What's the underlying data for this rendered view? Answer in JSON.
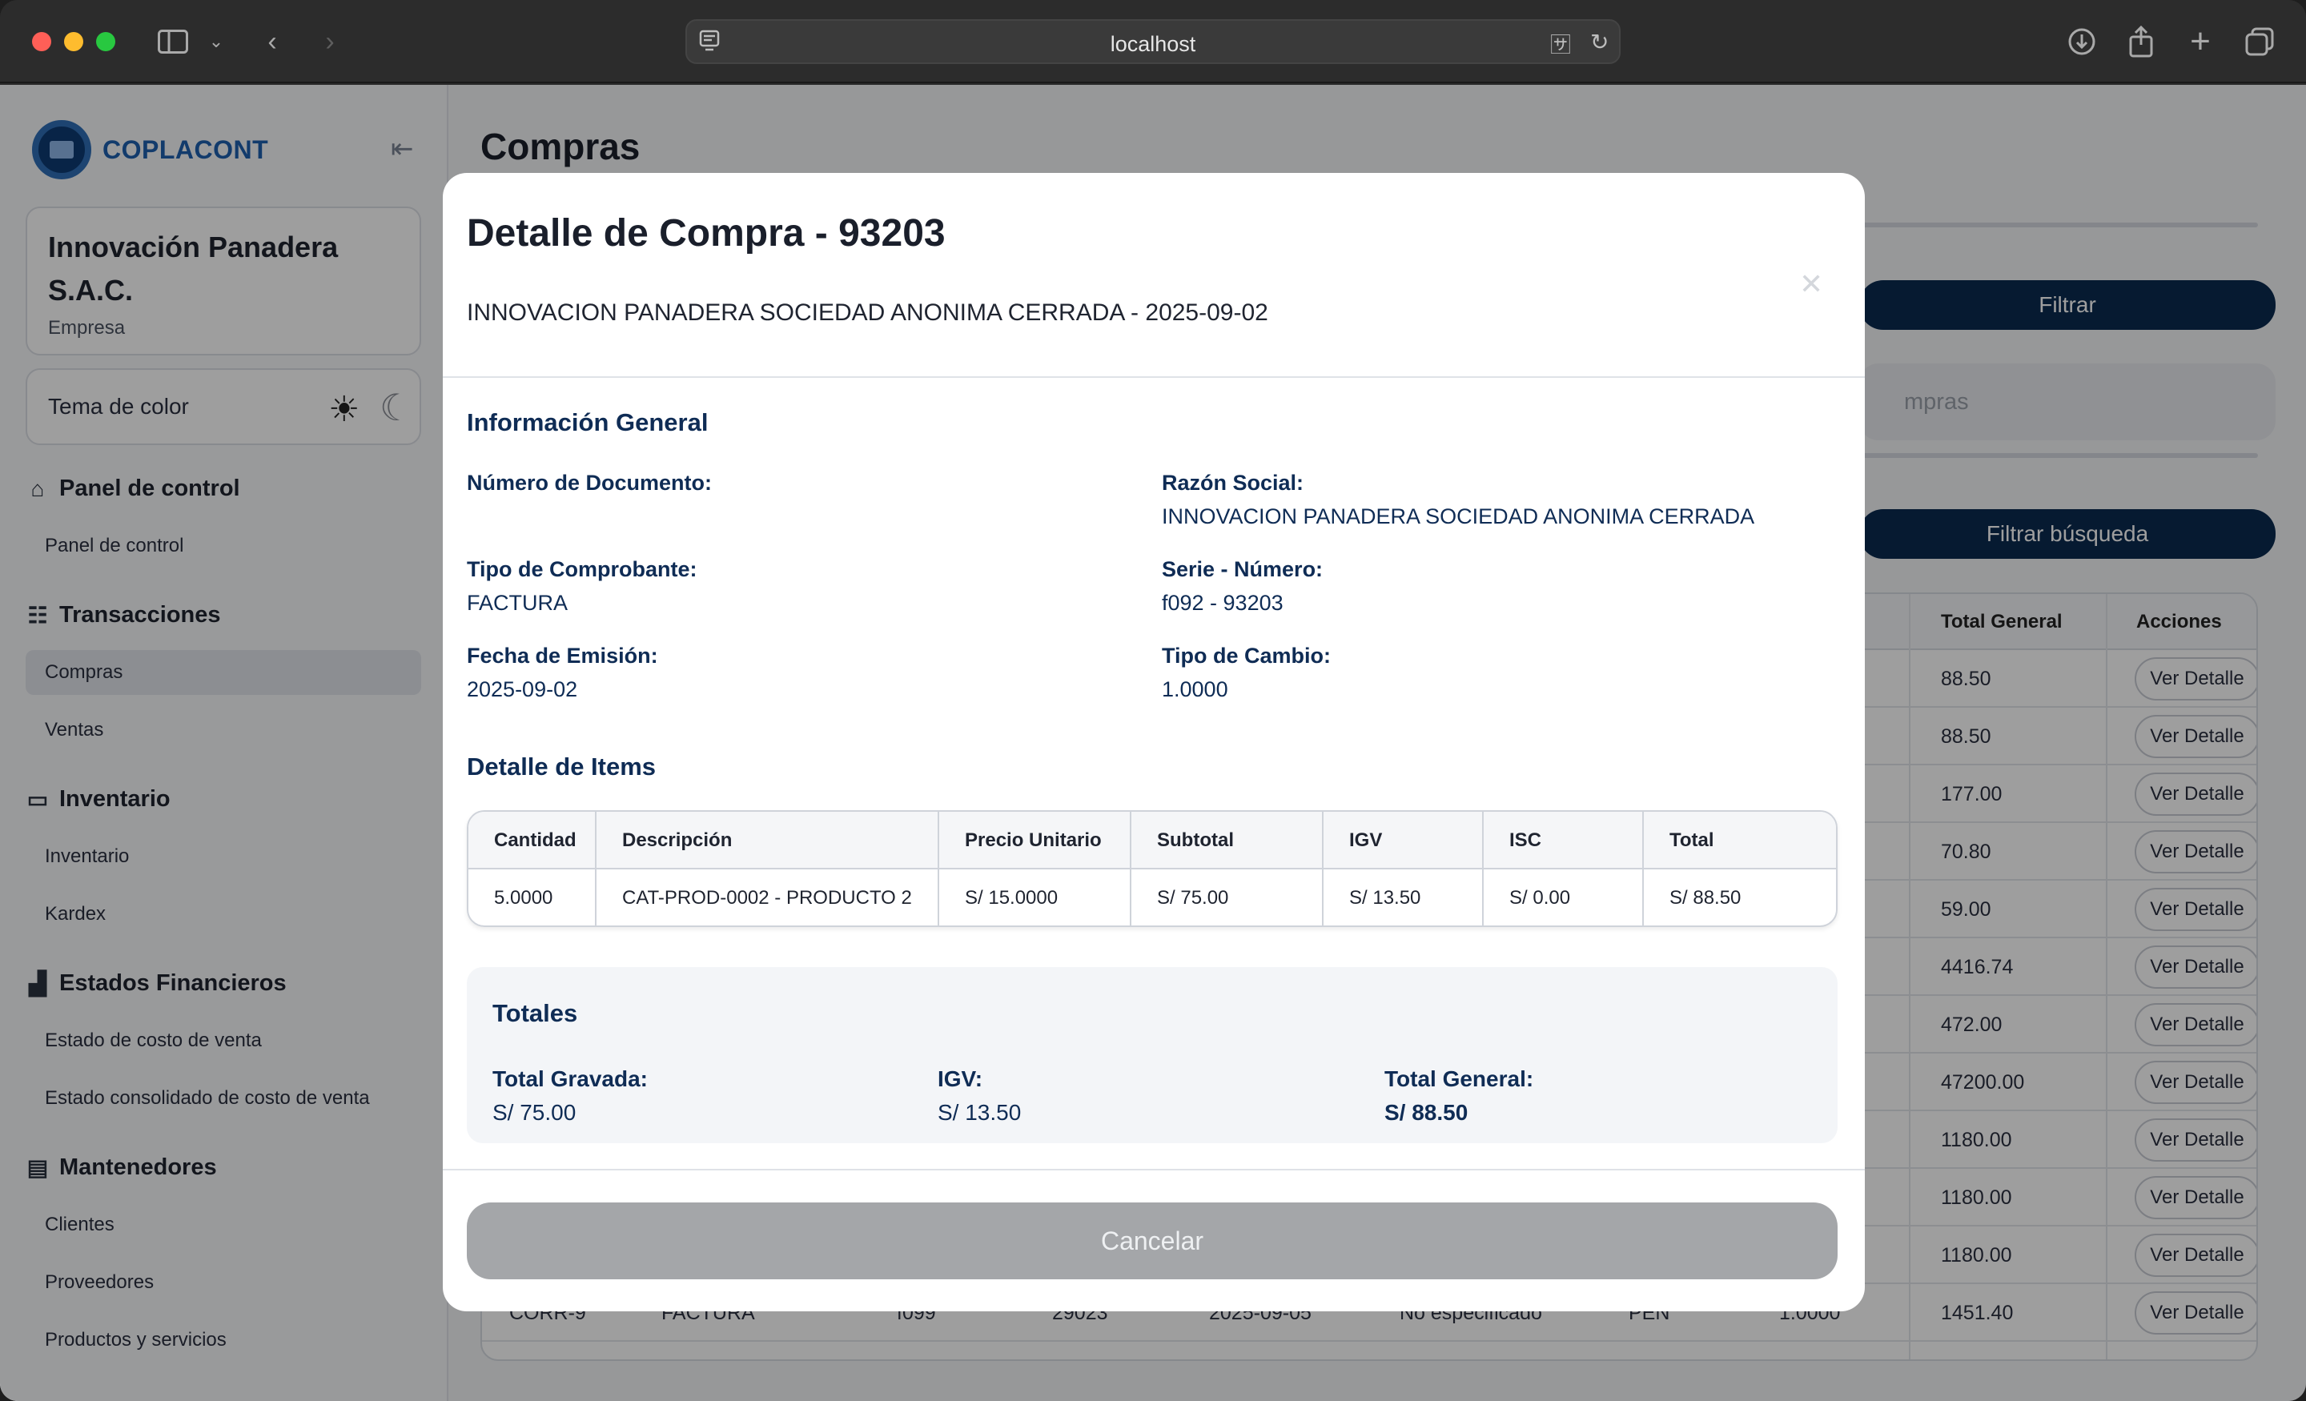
{
  "browser": {
    "address": "localhost"
  },
  "sidebar": {
    "logo_text": "COPLACONT",
    "company": {
      "name": "Innovación Panadera S.A.C.",
      "subtitle": "Empresa"
    },
    "theme_label": "Tema de color",
    "sections": [
      {
        "title": "Panel de control",
        "icon": "home-icon",
        "items": [
          "Panel de control"
        ]
      },
      {
        "title": "Transacciones",
        "icon": "list-icon",
        "items": [
          "Compras",
          "Ventas"
        ]
      },
      {
        "title": "Inventario",
        "icon": "box-icon",
        "items": [
          "Inventario",
          "Kardex"
        ]
      },
      {
        "title": "Estados Financieros",
        "icon": "chart-icon",
        "items": [
          "Estado de costo de venta",
          "Estado consolidado de costo de venta"
        ]
      },
      {
        "title": "Mantenedores",
        "icon": "book-icon",
        "items": [
          "Clientes",
          "Proveedores",
          "Productos y servicios"
        ]
      }
    ],
    "active_item": "Compras"
  },
  "page": {
    "title": "Compras",
    "filter_button": "Filtrar",
    "search_placeholder_partial": "mpras",
    "filter_search_button": "Filtrar búsqueda",
    "table_headers": {
      "total_general": "Total General",
      "acciones": "Acciones"
    },
    "table_totals": [
      "88.50",
      "88.50",
      "177.00",
      "70.80",
      "59.00",
      "4416.74",
      "472.00",
      "47200.00",
      "1180.00",
      "1180.00",
      "1180.00",
      "1451.40"
    ],
    "row_action_label": "Ver Detalle",
    "partial_row": {
      "code": "CORR-9",
      "type": "FACTURA",
      "serie": "f099",
      "numero": "29023",
      "fecha": "2025-09-05",
      "doc": "No especificado",
      "moneda": "PEN",
      "tc": "1.0000"
    }
  },
  "modal": {
    "title": "Detalle de Compra - 93203",
    "subtitle": "INNOVACION PANADERA SOCIEDAD ANONIMA CERRADA - 2025-09-02",
    "close_icon": "close-icon",
    "general": {
      "section_title": "Información General",
      "numero_documento_label": "Número de Documento:",
      "numero_documento_value": "",
      "razon_social_label": "Razón Social:",
      "razon_social_value": "INNOVACION PANADERA SOCIEDAD ANONIMA CERRADA",
      "tipo_comprobante_label": "Tipo de Comprobante:",
      "tipo_comprobante_value": "FACTURA",
      "serie_numero_label": "Serie - Número:",
      "serie_numero_value": "f092 - 93203",
      "fecha_emision_label": "Fecha de Emisión:",
      "fecha_emision_value": "2025-09-02",
      "tipo_cambio_label": "Tipo de Cambio:",
      "tipo_cambio_value": "1.0000"
    },
    "items": {
      "section_title": "Detalle de Items",
      "headers": [
        "Cantidad",
        "Descripción",
        "Precio Unitario",
        "Subtotal",
        "IGV",
        "ISC",
        "Total"
      ],
      "rows": [
        [
          "5.0000",
          "CAT-PROD-0002 - PRODUCTO 2",
          "S/ 15.0000",
          "S/ 75.00",
          "S/ 13.50",
          "S/ 0.00",
          "S/ 88.50"
        ]
      ]
    },
    "totals": {
      "section_title": "Totales",
      "gravada_label": "Total Gravada:",
      "gravada_value": "S/ 75.00",
      "igv_label": "IGV:",
      "igv_value": "S/ 13.50",
      "general_label": "Total General:",
      "general_value": "S/ 88.50"
    },
    "cancel_label": "Cancelar"
  }
}
